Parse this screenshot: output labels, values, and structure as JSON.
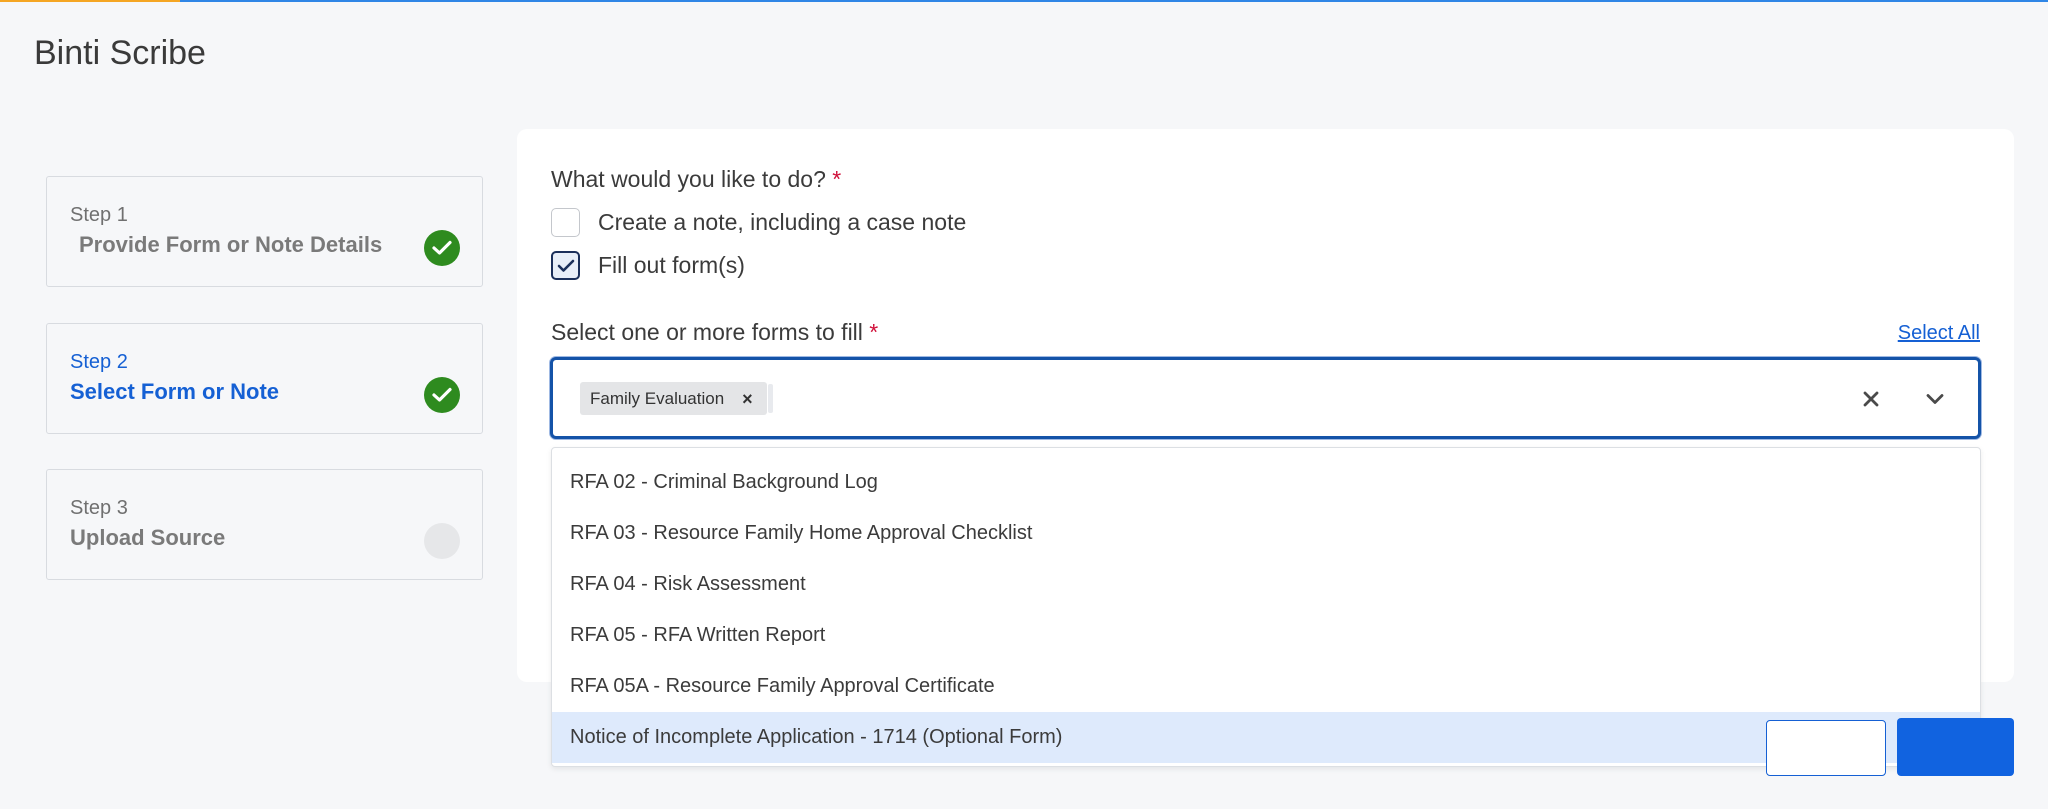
{
  "app": {
    "title": "Binti Scribe"
  },
  "steps": [
    {
      "label": "Step 1",
      "title": "Provide Form or Note Details",
      "status": "complete"
    },
    {
      "label": "Step 2",
      "title": "Select Form or Note",
      "status": "complete"
    },
    {
      "label": "Step 3",
      "title": "Upload Source",
      "status": "pending"
    }
  ],
  "question": {
    "label": "What would you like to do?",
    "required_mark": "*",
    "options": [
      {
        "label": "Create a note, including a case note",
        "checked": false
      },
      {
        "label": "Fill out form(s)",
        "checked": true
      }
    ]
  },
  "forms_select": {
    "label": "Select one or more forms to fill",
    "required_mark": "*",
    "select_all_label": "Select All",
    "selected_chips": [
      "Family Evaluation"
    ],
    "options": [
      "RFA 02 - Criminal Background Log",
      "RFA 03 - Resource Family Home Approval Checklist",
      "RFA 04 - Risk Assessment",
      "RFA 05 - RFA Written Report",
      "RFA 05A - Resource Family Approval Certificate",
      "Notice of Incomplete Application - 1714 (Optional Form)"
    ],
    "highlighted_option": "Notice of Incomplete Application - 1714 (Optional Form)"
  },
  "colors": {
    "accent_blue": "#1560d4",
    "check_green": "#2e8b1f",
    "required_red": "#d0103a",
    "highlight_bg": "#deeafc"
  }
}
